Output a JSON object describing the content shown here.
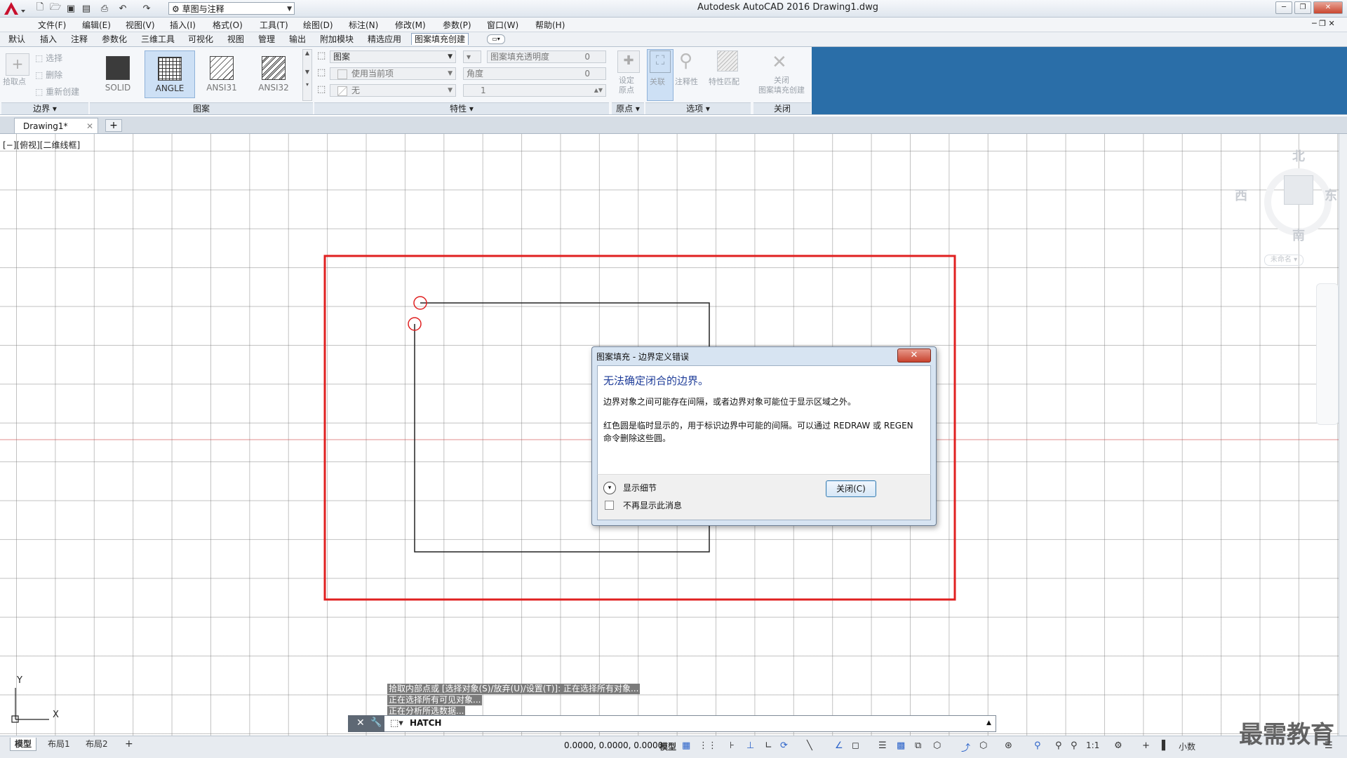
{
  "window": {
    "title": "Autodesk AutoCAD 2016    Drawing1.dwg",
    "workspace": "草图与注释"
  },
  "menu": [
    "文件(F)",
    "编辑(E)",
    "视图(V)",
    "插入(I)",
    "格式(O)",
    "工具(T)",
    "绘图(D)",
    "标注(N)",
    "修改(M)",
    "参数(P)",
    "窗口(W)",
    "帮助(H)"
  ],
  "ribbon_tabs": [
    "默认",
    "插入",
    "注释",
    "参数化",
    "三维工具",
    "可视化",
    "视图",
    "管理",
    "输出",
    "附加模块",
    "精选应用",
    "图案填充创建"
  ],
  "ribbon": {
    "boundary": {
      "pick_points": "拾取点",
      "select": "选择",
      "remove": "删除",
      "recreate": "重新创建",
      "title": "边界"
    },
    "patterns": {
      "items": [
        "SOLID",
        "ANGLE",
        "ANSI31",
        "ANSI32"
      ],
      "selected": "ANGLE",
      "title": "图案"
    },
    "properties": {
      "pattern_type": "图案",
      "use_current": "使用当前项",
      "none": "无",
      "transparency_label": "图案填充透明度",
      "transparency": "0",
      "angle_label": "角度",
      "angle": "0",
      "scale": "1",
      "title": "特性"
    },
    "origin": {
      "set": "设定",
      "origin": "原点",
      "title": "原点"
    },
    "options": {
      "associative": "关联",
      "annotative": "注释性",
      "match": "特性匹配",
      "title": "选项"
    },
    "close": {
      "close": "关闭",
      "create": "图案填充创建",
      "title": "关闭"
    }
  },
  "doc_tab": "Drawing1*",
  "viewport_label": "[−][俯视][二维线框]",
  "viewcube": {
    "north": "北",
    "south": "南",
    "east": "东",
    "west": "西",
    "wcs": "未命名"
  },
  "dialog": {
    "title": "图案填充 - 边界定义错误",
    "heading": "无法确定闭合的边界。",
    "line1": "边界对象之间可能存在间隔，或者边界对象可能位于显示区域之外。",
    "line2": "红色圆是临时显示的，用于标识边界中可能的间隔。可以通过 REDRAW 或 REGEN",
    "line3": "命令删除这些圆。",
    "details": "显示细节",
    "dont_show": "不再显示此消息",
    "close_button": "关闭(C)"
  },
  "command": {
    "history": [
      "拾取内部点或 [选择对象(S)/放弃(U)/设置(T)]: 正在选择所有对象...",
      "正在选择所有可见对象...",
      "正在分析所选数据..."
    ],
    "current": "HATCH"
  },
  "layout_tabs": [
    "模型",
    "布局1",
    "布局2"
  ],
  "status": {
    "coords": "0.0000, 0.0000, 0.0000",
    "model": "模型",
    "scale": "1:1",
    "units": "小数"
  },
  "watermark": "最需教育",
  "colors": {
    "accent": "#1f3d99",
    "highlight": "#e02020",
    "ribbon_active": "#cde0f5"
  }
}
